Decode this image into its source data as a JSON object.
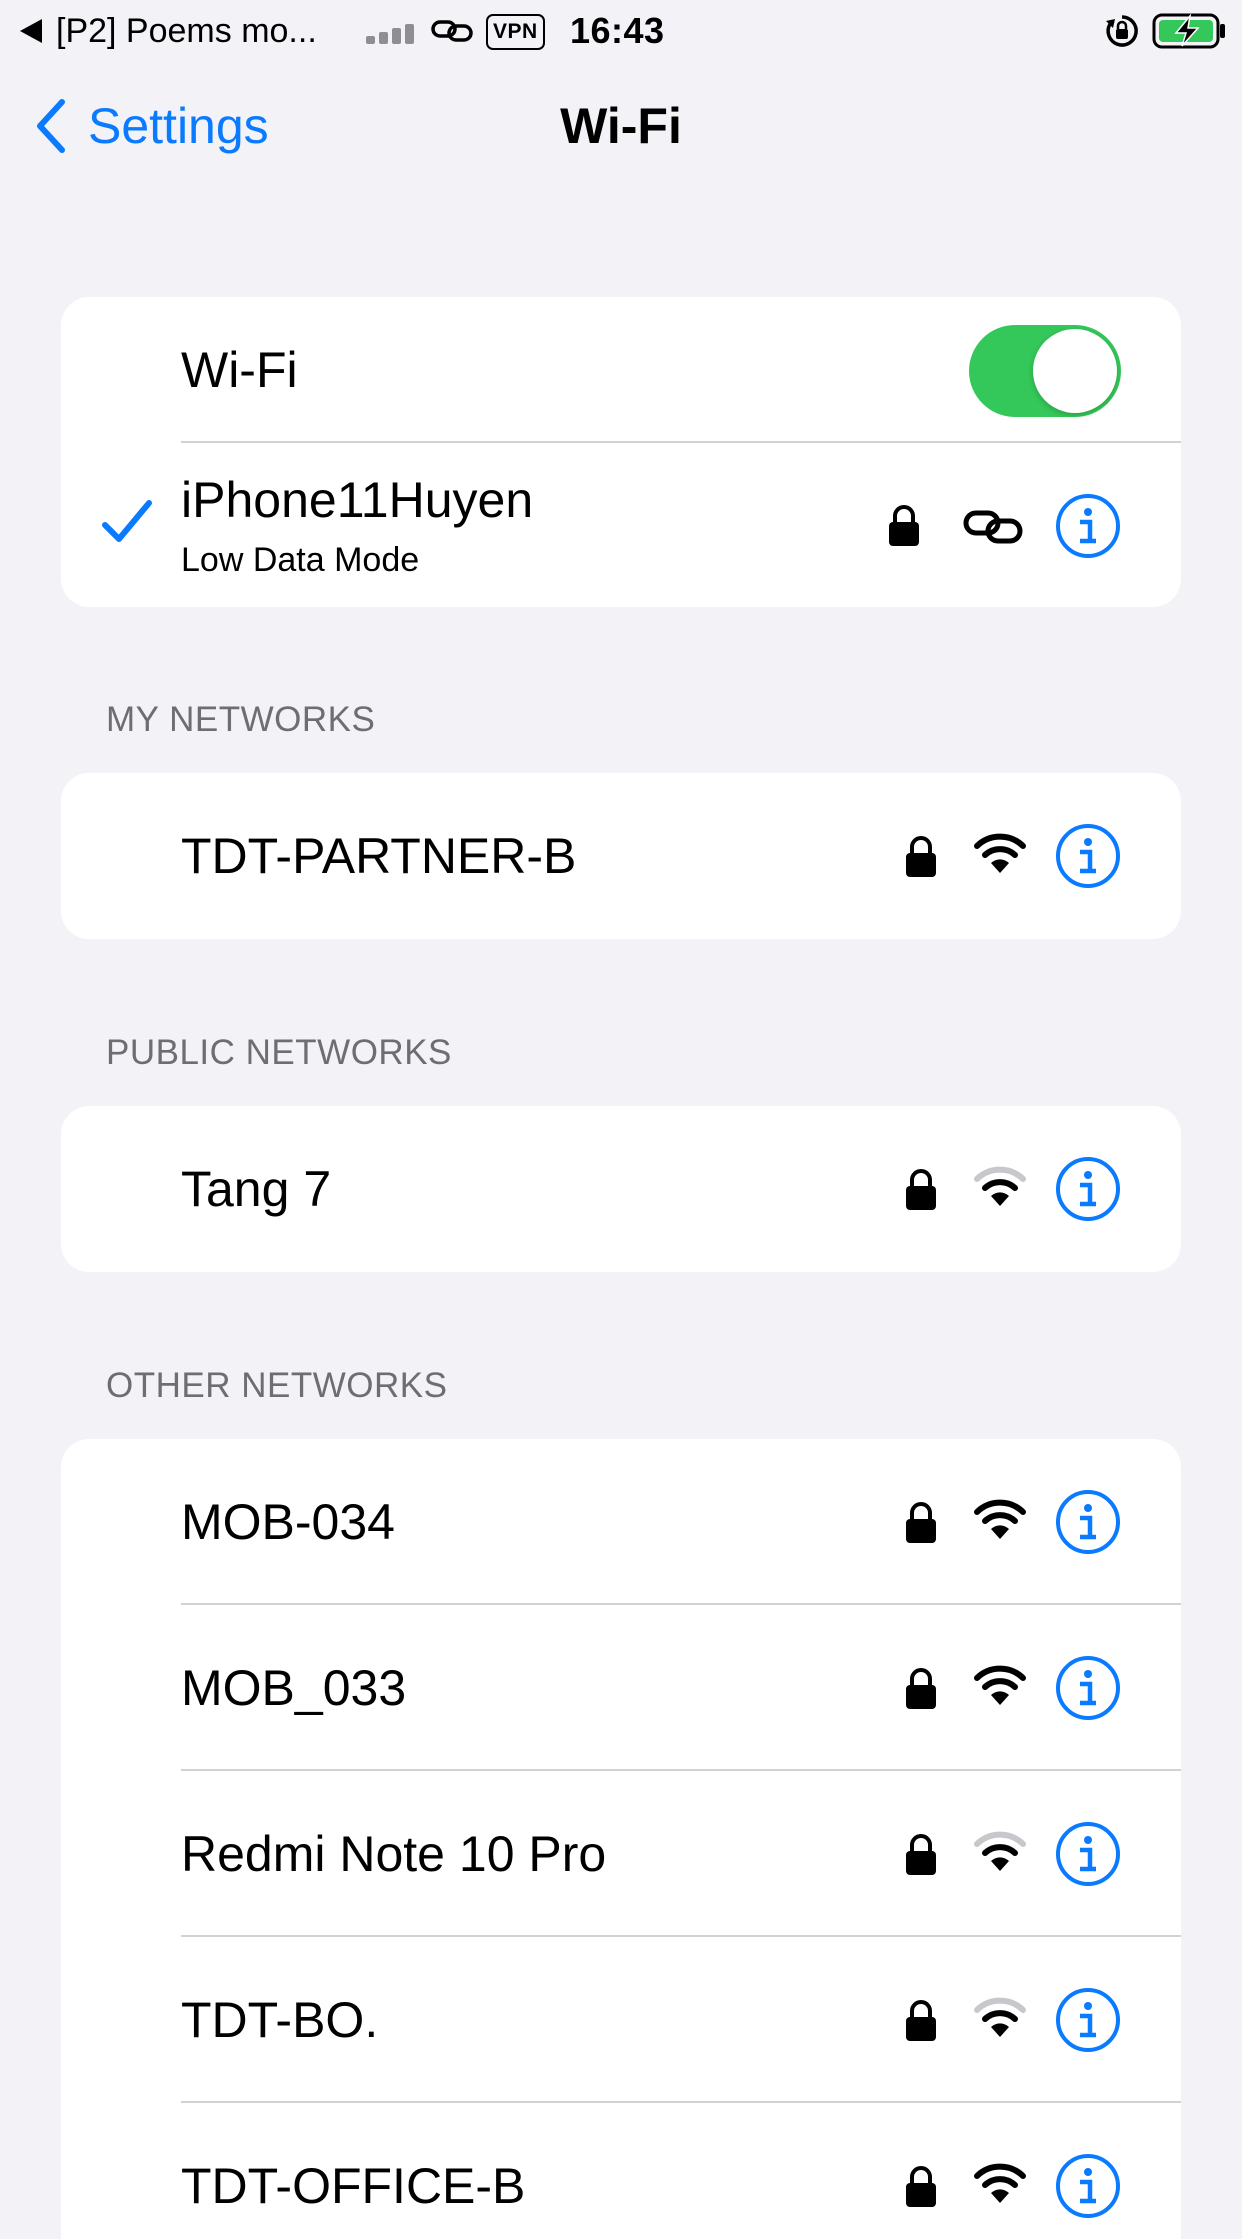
{
  "status_bar": {
    "back_app": "[P2] Poems mo...",
    "vpn": "VPN",
    "time": "16:43"
  },
  "nav": {
    "back_label": "Settings",
    "title": "Wi-Fi"
  },
  "wifi_toggle": {
    "label": "Wi-Fi",
    "on": true
  },
  "connected": {
    "name": "iPhone11Huyen",
    "subtitle": "Low Data Mode",
    "icons": [
      "checkmark-icon",
      "lock-icon",
      "personal-hotspot-link-icon",
      "info-icon"
    ]
  },
  "sections": {
    "my_networks": "MY NETWORKS",
    "public_networks": "PUBLIC NETWORKS",
    "other_networks": "OTHER NETWORKS"
  },
  "my_networks": [
    {
      "name": "TDT-PARTNER-B",
      "signal_bars": 3,
      "secured": true
    }
  ],
  "public_networks": [
    {
      "name": "Tang 7",
      "signal_bars": 2,
      "secured": true
    }
  ],
  "other_networks": [
    {
      "name": "MOB-034",
      "signal_bars": 3,
      "secured": true
    },
    {
      "name": "MOB_033",
      "signal_bars": 3,
      "secured": true
    },
    {
      "name": "Redmi Note 10 Pro",
      "signal_bars": 2,
      "secured": true
    },
    {
      "name": "TDT-BO.",
      "signal_bars": 2,
      "secured": true
    },
    {
      "name": "TDT-OFFICE-B",
      "signal_bars": 3,
      "secured": true
    }
  ],
  "colors": {
    "accent": "#0a7aff",
    "toggle_on": "#34c759",
    "background": "#f2f2f7",
    "separator": "#d1d1d6",
    "section_text": "#6d6d72",
    "charging_battery": "#34c759"
  }
}
